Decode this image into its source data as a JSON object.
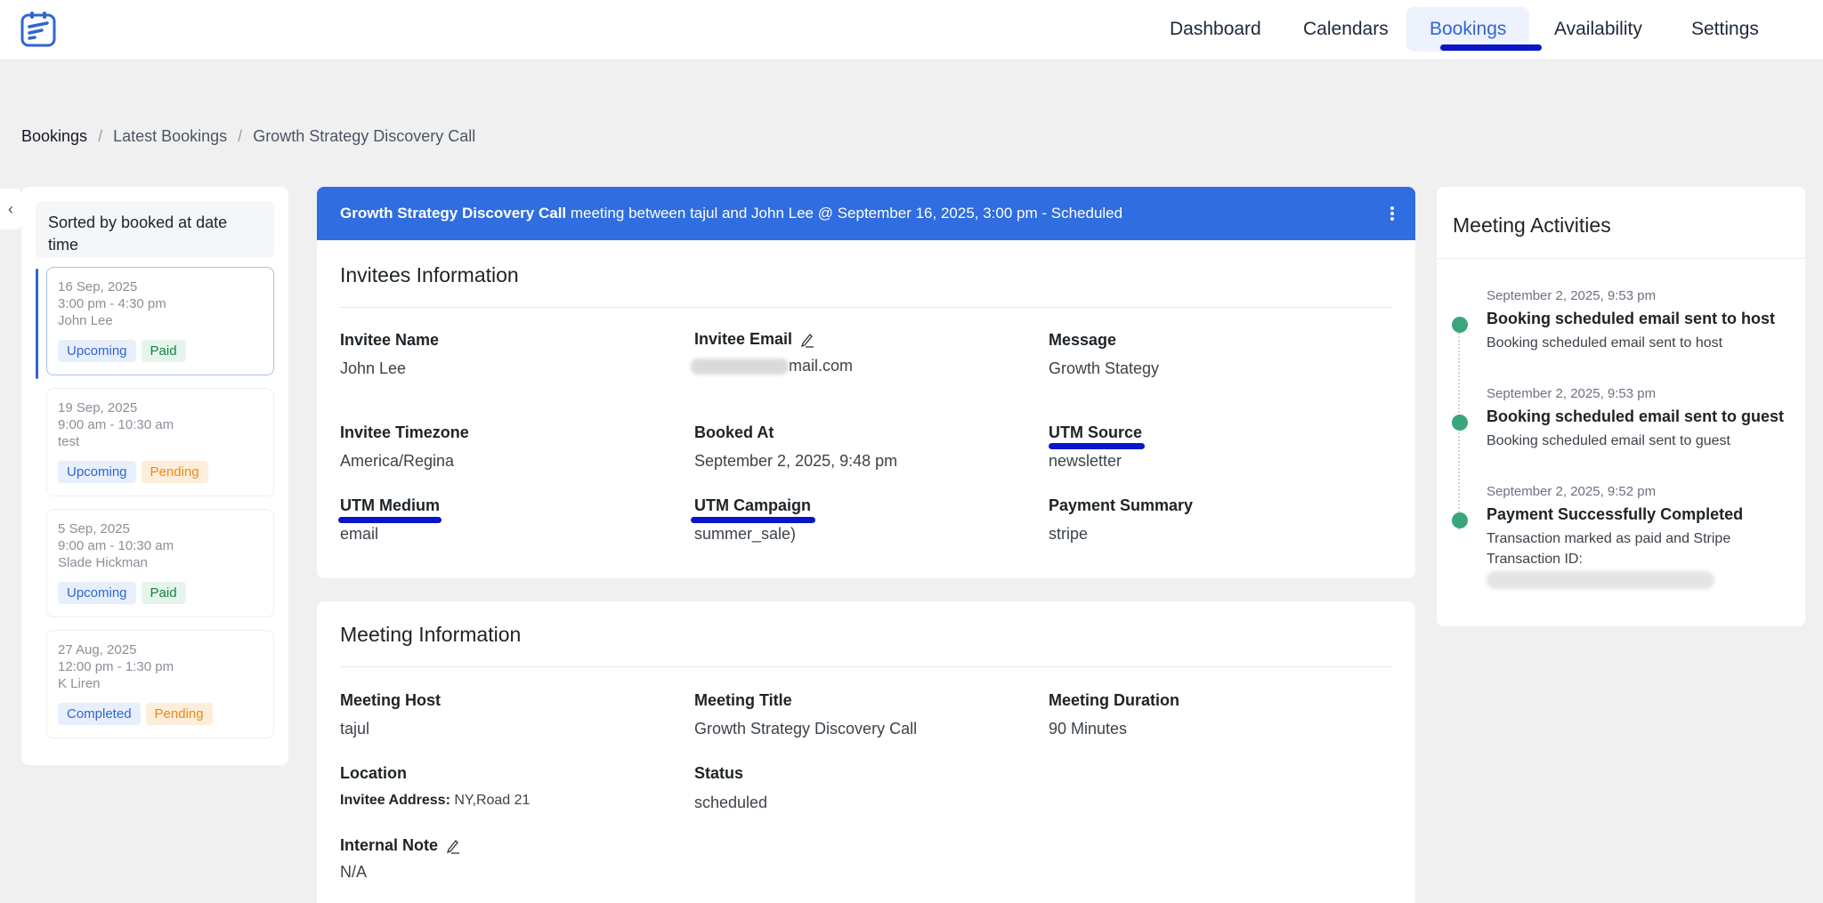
{
  "nav": {
    "items": [
      "Dashboard",
      "Calendars",
      "Bookings",
      "Availability",
      "Settings"
    ],
    "active": "Bookings"
  },
  "breadcrumb": [
    "Bookings",
    "Latest Bookings",
    "Growth Strategy Discovery Call"
  ],
  "left_panel": {
    "collapse_icon": "chevron-left-icon",
    "sort_label": "Sorted by booked at date time",
    "bookings": [
      {
        "date": "16 Sep, 2025",
        "time": "3:00 pm - 4:30 pm",
        "name": "John Lee",
        "status": "Upcoming",
        "payment": "Paid"
      },
      {
        "date": "19 Sep, 2025",
        "time": "9:00 am - 10:30 am",
        "name": "test",
        "status": "Upcoming",
        "payment": "Pending"
      },
      {
        "date": "5 Sep, 2025",
        "time": "9:00 am - 10:30 am",
        "name": "Slade Hickman",
        "status": "Upcoming",
        "payment": "Paid"
      },
      {
        "date": "27 Aug, 2025",
        "time": "12:00 pm - 1:30 pm",
        "name": "K Liren",
        "status": "Completed",
        "payment": "Pending"
      }
    ]
  },
  "header": {
    "title": "Growth Strategy Discovery Call",
    "rest": " meeting between tajul and John Lee @ September 16, 2025, 3:00 pm - Scheduled",
    "menu_icon": "kebab-menu-icon"
  },
  "invitees": {
    "title": "Invitees Information",
    "invitee_name_label": "Invitee Name",
    "invitee_name": "John Lee",
    "invitee_email_label": "Invitee Email",
    "invitee_email_visible": "mail.com",
    "message_label": "Message",
    "message": "Growth Stategy",
    "timezone_label": "Invitee Timezone",
    "timezone": "America/Regina",
    "booked_at_label": "Booked At",
    "booked_at": "September 2, 2025, 9:48 pm",
    "utm_source_label": "UTM Source",
    "utm_source": "newsletter",
    "utm_medium_label": "UTM Medium",
    "utm_medium": "email",
    "utm_campaign_label": "UTM Campaign",
    "utm_campaign": "summer_sale)",
    "payment_summary_label": "Payment Summary",
    "payment_summary": "stripe"
  },
  "meeting": {
    "title": "Meeting Information",
    "host_label": "Meeting Host",
    "host": "tajul",
    "meeting_title_label": "Meeting Title",
    "meeting_title": "Growth Strategy Discovery Call",
    "duration_label": "Meeting Duration",
    "duration": "90 Minutes",
    "location_label": "Location",
    "location_prefix": "Invitee Address:",
    "location_value": " NY,Road 21",
    "status_label": "Status",
    "status": "scheduled",
    "note_label": "Internal Note",
    "note": "N/A"
  },
  "activities": {
    "title": "Meeting Activities",
    "items": [
      {
        "time": "September 2, 2025, 9:53 pm",
        "title": "Booking scheduled email sent to host",
        "desc": "Booking scheduled email sent to host"
      },
      {
        "time": "September 2, 2025, 9:53 pm",
        "title": "Booking scheduled email sent to guest",
        "desc": "Booking scheduled email sent to guest"
      },
      {
        "time": "September 2, 2025, 9:52 pm",
        "title": "Payment Successfully Completed",
        "desc": "Transaction marked as paid and Stripe Transaction ID:"
      }
    ]
  },
  "colors": {
    "accent": "#2f6de0",
    "annotation_underline": "#0a14c8",
    "success": "#3ba57d"
  }
}
